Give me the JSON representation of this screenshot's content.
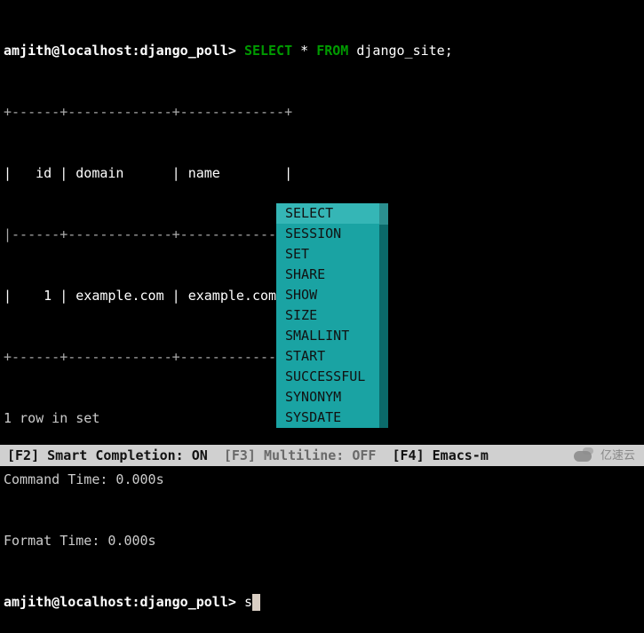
{
  "prompt": "amjith@localhost:django_poll>",
  "query": {
    "kw_select": "SELECT",
    "star": " * ",
    "kw_from": "FROM",
    "ident": " django_site;"
  },
  "table": {
    "top": "+------+-------------+-------------+",
    "header": "|   id | domain      | name        |",
    "sep": "|------+-------------+-------------|",
    "row1": "|    1 | example.com | example.com |",
    "bottom": "+------+-------------+-------------+"
  },
  "rows_in_set": "1 row in set",
  "command_time": "Command Time: 0.000s",
  "format_time": "Format Time: 0.000s",
  "typed": "s",
  "autocomplete": {
    "items": [
      "SELECT",
      "SESSION",
      "SET",
      "SHARE",
      "SHOW",
      "SIZE",
      "SMALLINT",
      "START",
      "SUCCESSFUL",
      "SYNONYM",
      "SYSDATE"
    ],
    "selected_index": 0
  },
  "statusbar": {
    "f2_key": "[F2]",
    "f2_label": " Smart Completion: ",
    "f2_state": "ON",
    "f3_key": "[F3]",
    "f3_label": " Multiline: ",
    "f3_state": "OFF",
    "f4_key": "[F4]",
    "f4_label": " Emacs-m"
  },
  "watermark": "亿速云"
}
